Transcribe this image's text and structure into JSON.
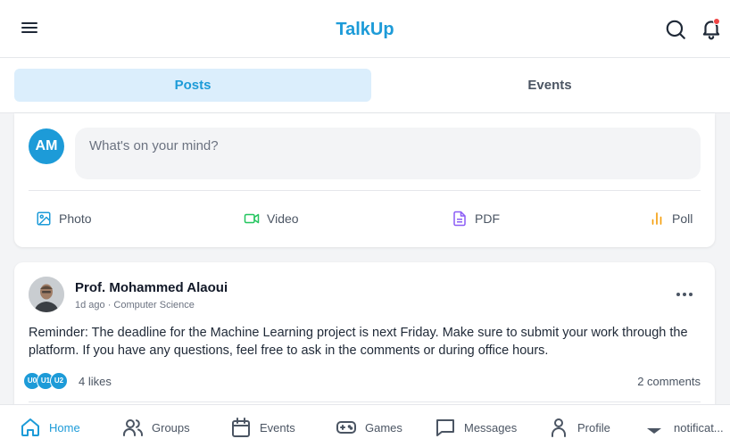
{
  "header": {
    "title": "TalkUp",
    "menu_icon": "menu-icon",
    "search_icon": "search-icon",
    "bell_icon": "bell-icon",
    "accent": "#1d9bd8"
  },
  "tabs": [
    {
      "label": "Posts",
      "active": true
    },
    {
      "label": "Events",
      "active": false
    }
  ],
  "composer": {
    "avatar_initials": "AM",
    "placeholder": "What's on your mind?",
    "actions": [
      {
        "label": "Photo",
        "icon": "image-icon",
        "color": "#1d9bd8"
      },
      {
        "label": "Video",
        "icon": "video-icon",
        "color": "#22c55e"
      },
      {
        "label": "PDF",
        "icon": "file-icon",
        "color": "#8b5cf6"
      },
      {
        "label": "Poll",
        "icon": "bar-chart-icon",
        "color": "#f59e0b"
      }
    ]
  },
  "post": {
    "author": "Prof. Mohammed Alaoui",
    "meta": "1d ago · Computer Science",
    "text": "Reminder: The deadline for the Machine Learning project is next Friday. Make sure to submit your work through the platform. If you have any questions, feel free to ask in the comments or during office hours.",
    "likers": [
      "U0",
      "U1",
      "U2"
    ],
    "likes": "4 likes",
    "comments": "2 comments"
  },
  "bottom_nav": [
    {
      "label": "Home",
      "icon": "home-icon",
      "active": true
    },
    {
      "label": "Groups",
      "icon": "users-icon",
      "active": false
    },
    {
      "label": "Events",
      "icon": "calendar-icon",
      "active": false
    },
    {
      "label": "Games",
      "icon": "gamepad-icon",
      "active": false
    },
    {
      "label": "Messages",
      "icon": "message-icon",
      "active": false
    },
    {
      "label": "Profile",
      "icon": "user-icon",
      "active": false
    },
    {
      "label": "notificat...",
      "icon": "chevron-down-icon",
      "active": false
    }
  ]
}
